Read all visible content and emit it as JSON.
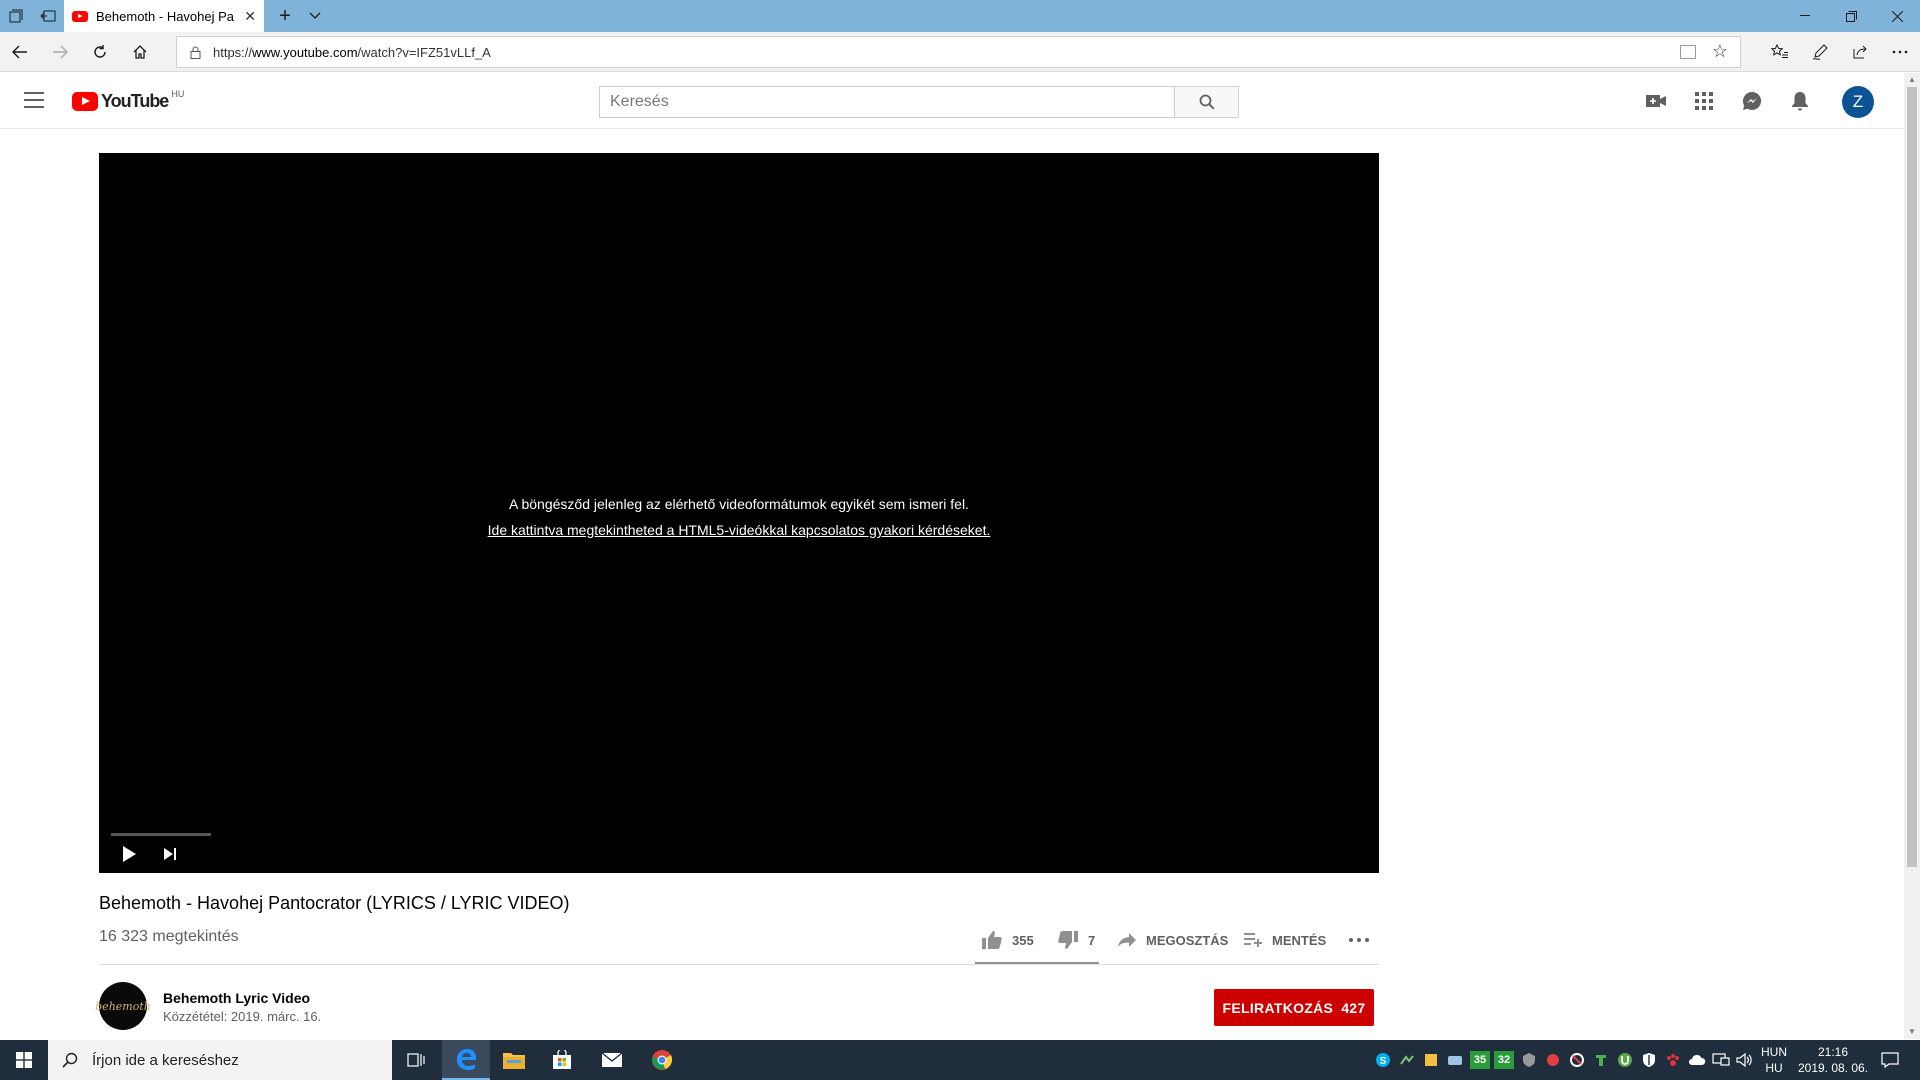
{
  "browser": {
    "tab_title": "Behemoth - Havohej Pa",
    "url_prefix": "https://",
    "url_host": "www.youtube.com",
    "url_path": "/watch?v=IFZ51vLLf_A"
  },
  "youtube": {
    "logo_text": "YouTube",
    "region": "HU",
    "search_placeholder": "Keresés",
    "avatar_letter": "Z"
  },
  "player": {
    "message_line1": "A böngésződ jelenleg az elérhető videoformátumok egyikét sem ismeri fel.",
    "message_link": "Ide kattintva megtekintheted a HTML5-videókkal kapcsolatos gyakori kérdéseket."
  },
  "video": {
    "title": "Behemoth - Havohej Pantocrator (LYRICS / LYRIC VIDEO)",
    "views": "16 323 megtekintés",
    "likes": "355",
    "dislikes": "7",
    "share_label": "MEGOSZTÁS",
    "save_label": "MENTÉS"
  },
  "channel": {
    "name": "Behemoth Lyric Video",
    "published": "Közzététel: 2019. márc. 16.",
    "avatar_text": "behemoth",
    "subscribe_label": "FELIRATKOZÁS",
    "subscriber_count": "427"
  },
  "taskbar": {
    "search_placeholder": "Írjon ide a kereséshez",
    "badge_1": "35",
    "badge_2": "32",
    "lang_top": "HUN",
    "lang_bottom": "HU",
    "time": "21:16",
    "date": "2019. 08. 06."
  },
  "colors": {
    "youtube_red": "#ff0000",
    "subscribe_red": "#cc0000",
    "tabbar_blue": "#7fb3d9",
    "avatar_blue": "#0b5394",
    "taskbar_bg": "#1f2d3d"
  }
}
